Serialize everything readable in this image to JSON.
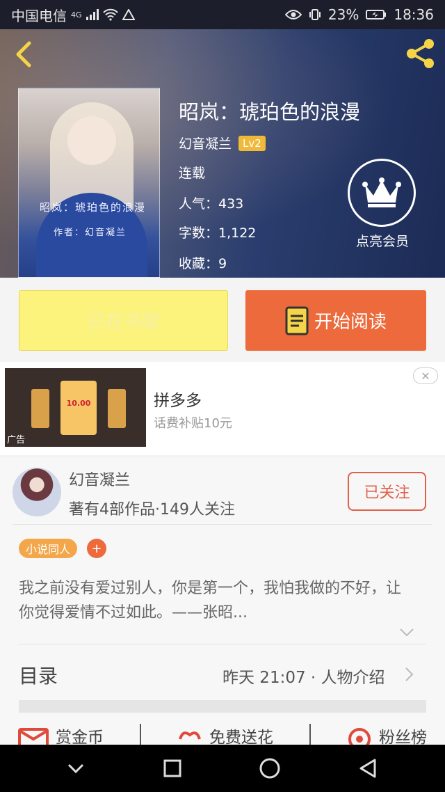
{
  "status_bar": {
    "carrier": "中国电信",
    "network": "4G",
    "battery": "23%",
    "time": "18:36"
  },
  "book": {
    "cover_title": "昭岚：琥珀色的浪漫",
    "cover_author": "作者：幻音凝兰",
    "title": "昭岚：琥珀色的浪漫",
    "author": "幻音凝兰",
    "level": "Lv2",
    "status": "连载",
    "popularity": "人气：433",
    "word_count": "字数：1,122",
    "favorites": "收藏：9"
  },
  "vip": {
    "label": "点亮会员"
  },
  "buttons": {
    "shelf": "已在书架",
    "read": "开始阅读"
  },
  "ad": {
    "title": "拼多多",
    "subtitle": "话费补贴10元",
    "price": "10.00",
    "tag": "广告"
  },
  "author_panel": {
    "name": "幻音凝兰",
    "stats": "著有4部作品·149人关注",
    "follow": "已关注",
    "tag": "小说同人",
    "tag_add": "+",
    "description": "我之前没有爱过别人，你是第一个，我怕我做的不好，让你觉得爱情不过如此。——张昭..."
  },
  "toc": {
    "title": "目录",
    "info": "昨天 21:07 · 人物介绍"
  },
  "actions": [
    {
      "label": "赏金币",
      "icon": "envelope-icon"
    },
    {
      "label": "免费送花",
      "icon": "flower-icon"
    },
    {
      "label": "粉丝榜",
      "icon": "ranking-icon"
    }
  ],
  "colors": {
    "accent": "#ec6a3b",
    "shelf_bg": "#fbf37c",
    "badge": "#f0b93a",
    "tag": "#f3a74a"
  }
}
